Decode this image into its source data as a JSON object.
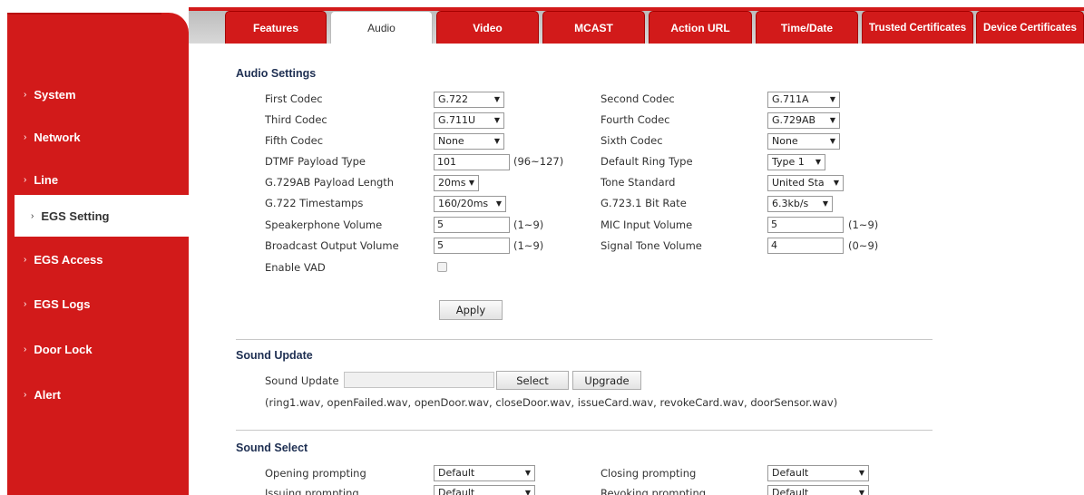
{
  "sidebar": {
    "items": [
      {
        "label": "System"
      },
      {
        "label": "Network"
      },
      {
        "label": "Line"
      },
      {
        "label": "EGS Setting"
      },
      {
        "label": "EGS Access"
      },
      {
        "label": "EGS Logs"
      },
      {
        "label": "Door Lock"
      },
      {
        "label": "Alert"
      }
    ],
    "active_index": 3,
    "chevron": "›"
  },
  "tabs": [
    {
      "label": "Features"
    },
    {
      "label": "Audio"
    },
    {
      "label": "Video"
    },
    {
      "label": "MCAST"
    },
    {
      "label": "Action URL"
    },
    {
      "label": "Time/Date"
    },
    {
      "label": "Trusted Certificates"
    },
    {
      "label": "Device Certificates"
    }
  ],
  "active_tab": "Audio",
  "audio_settings": {
    "title": "Audio Settings",
    "first_codec": {
      "label": "First Codec",
      "value": "G.722"
    },
    "second_codec": {
      "label": "Second Codec",
      "value": "G.711A"
    },
    "third_codec": {
      "label": "Third Codec",
      "value": "G.711U"
    },
    "fourth_codec": {
      "label": "Fourth Codec",
      "value": "G.729AB"
    },
    "fifth_codec": {
      "label": "Fifth Codec",
      "value": "None"
    },
    "sixth_codec": {
      "label": "Sixth Codec",
      "value": "None"
    },
    "dtmf_payload": {
      "label": "DTMF Payload Type",
      "value": "101",
      "range": "(96~127)"
    },
    "default_ring": {
      "label": "Default Ring Type",
      "value": "Type 1"
    },
    "g729ab_length": {
      "label": "G.729AB Payload Length",
      "value": "20ms"
    },
    "tone_standard": {
      "label": "Tone Standard",
      "value": "United Sta"
    },
    "g722_timestamps": {
      "label": "G.722 Timestamps",
      "value": "160/20ms"
    },
    "g7231_bitrate": {
      "label": "G.723.1 Bit Rate",
      "value": "6.3kb/s"
    },
    "speaker_volume": {
      "label": "Speakerphone Volume",
      "value": "5",
      "range": "(1~9)"
    },
    "mic_volume": {
      "label": "MIC Input Volume",
      "value": "5",
      "range": "(1~9)"
    },
    "broadcast_volume": {
      "label": "Broadcast Output Volume",
      "value": "5",
      "range": "(1~9)"
    },
    "signal_tone_volume": {
      "label": "Signal Tone Volume",
      "value": "4",
      "range": "(0~9)"
    },
    "enable_vad": {
      "label": "Enable VAD",
      "checked": false
    },
    "apply_label": "Apply"
  },
  "sound_update": {
    "title": "Sound Update",
    "label": "Sound Update",
    "file_value": "",
    "select_label": "Select",
    "upgrade_label": "Upgrade",
    "files_note": "(ring1.wav, openFailed.wav, openDoor.wav, closeDoor.wav, issueCard.wav, revokeCard.wav, doorSensor.wav)"
  },
  "sound_select": {
    "title": "Sound Select",
    "opening": {
      "label": "Opening prompting",
      "value": "Default"
    },
    "closing": {
      "label": "Closing prompting",
      "value": "Default"
    },
    "issuing": {
      "label": "Issuing prompting",
      "value": "Default"
    },
    "revoking": {
      "label": "Revoking prompting",
      "value": "Default"
    }
  },
  "icons": {
    "dropdown": "▼"
  },
  "colors": {
    "brand_red": "#d21a1a",
    "section_title": "#1e2f52"
  }
}
